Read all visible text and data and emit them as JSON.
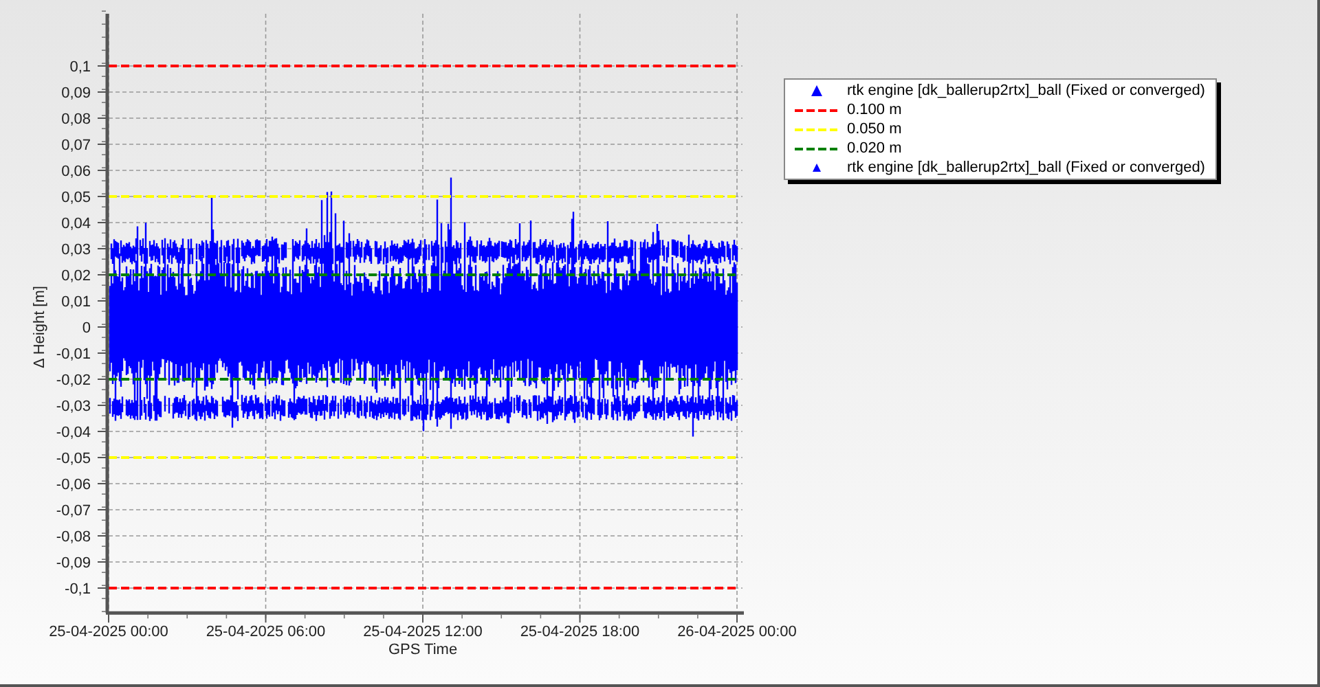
{
  "chart": {
    "chart_data": {
      "type": "line",
      "grid": true,
      "ylabel": "Δ Height [m]",
      "xlabel": "GPS Time",
      "ylim": [
        -0.109,
        0.12
      ],
      "categories": [
        "25-04-2025 00:00",
        "25-04-2025 06:00",
        "25-04-2025 12:00",
        "25-04-2025 18:00",
        "26-04-2025 00:00"
      ],
      "yticks": [
        {
          "value": 0.1,
          "label": "0,1"
        },
        {
          "value": 0.09,
          "label": "0,09"
        },
        {
          "value": 0.08,
          "label": "0,08"
        },
        {
          "value": 0.07,
          "label": "0,07"
        },
        {
          "value": 0.06,
          "label": "0,06"
        },
        {
          "value": 0.05,
          "label": "0,05"
        },
        {
          "value": 0.04,
          "label": "0,04"
        },
        {
          "value": 0.03,
          "label": "0,03"
        },
        {
          "value": 0.02,
          "label": "0,02"
        },
        {
          "value": 0.01,
          "label": "0,01"
        },
        {
          "value": 0,
          "label": "0"
        },
        {
          "value": -0.01,
          "label": "-0,01"
        },
        {
          "value": -0.02,
          "label": "-0,02"
        },
        {
          "value": -0.03,
          "label": "-0,03"
        },
        {
          "value": -0.04,
          "label": "-0,04"
        },
        {
          "value": -0.05,
          "label": "-0,05"
        },
        {
          "value": -0.06,
          "label": "-0,06"
        },
        {
          "value": -0.07,
          "label": "-0,07"
        },
        {
          "value": -0.08,
          "label": "-0,08"
        },
        {
          "value": -0.09,
          "label": "-0,09"
        },
        {
          "value": -0.1,
          "label": "-0,1"
        }
      ],
      "series": [
        {
          "color": "#ff0000",
          "line_style": "dashed",
          "values": [
            0.1,
            0.1,
            0.1,
            0.1,
            0.1
          ]
        },
        {
          "color": "#ff0000",
          "line_style": "dashed",
          "values": [
            -0.1,
            -0.1,
            -0.1,
            -0.1,
            -0.1
          ]
        },
        {
          "color": "#ffff00",
          "line_style": "dashed",
          "values": [
            0.05,
            0.05,
            0.05,
            0.05,
            0.05
          ]
        },
        {
          "color": "#ffff00",
          "line_style": "dashed",
          "values": [
            -0.05,
            -0.05,
            -0.05,
            -0.05,
            -0.05
          ]
        },
        {
          "color": "#008000",
          "line_style": "dashed",
          "values": [
            0.02,
            0.02,
            0.02,
            0.02,
            0.02
          ]
        },
        {
          "color": "#008000",
          "line_style": "dashed",
          "values": [
            -0.02,
            -0.02,
            -0.02,
            -0.02,
            -0.02
          ]
        }
      ]
    }
  },
  "legend": [
    {
      "kind": "marker",
      "label": "rtk engine [dk_ballerup2rtx]_ball (Fixed or converged)",
      "color": "#0000ff"
    },
    {
      "kind": "dashed",
      "label": "0.100 m",
      "color": "#ff0000"
    },
    {
      "kind": "dashed",
      "label": "0.050 m",
      "color": "#ffff00"
    },
    {
      "kind": "dashed",
      "label": "0.020 m",
      "color": "#008000"
    },
    {
      "kind": "small-marker",
      "label": "rtk engine [dk_ballerup2rtx]_ball (Fixed or converged)",
      "color": "#0000ff"
    }
  ]
}
